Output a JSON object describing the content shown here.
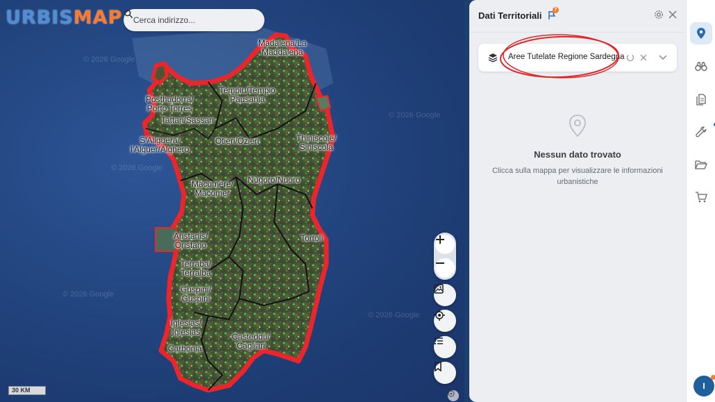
{
  "app": {
    "logo_part1": "URBIS",
    "logo_part2": "MAP"
  },
  "search": {
    "placeholder": "Cerca indirizzo..."
  },
  "map": {
    "labels": [
      "Madalena/La\nMaddalena",
      "Tempiu/Tempio\nPausania",
      "Posthudorra/\nPorto Torres",
      "Tattari/Sassari",
      "S'Aliguera/\nl'Alguer/Alghero",
      "Otieri/Ozieri",
      "Thiniscole/\nSiniscola",
      "Macumere/\nMacomer",
      "Nùgoro/Nuoro",
      "Aristanis/\nOristano",
      "Tortolì",
      "Terraba/\nTerralba",
      "Guspini/\nGuspini",
      "Iglesias/\nIglesias",
      "Casteddu/\nCagliari",
      "Carbonia"
    ],
    "watermarks": [
      "© 2026 Google",
      "© 2026 Google",
      "© 2026 Google",
      "© 2026 Google",
      "© 2026 Google"
    ],
    "scale_label": "30 KM"
  },
  "panel": {
    "title": "Dati Territoriali",
    "notification_count": "7",
    "layer_name": "Aree Tutelate Regione Sardegna",
    "empty_title": "Nessun dato trovato",
    "empty_description": "Clicca sulla mappa per visualizzare le informazioni urbanistiche"
  },
  "user": {
    "avatar_initial": "I"
  },
  "colors": {
    "accent": "#2b6cb0",
    "logo_orange": "#ff7a2b",
    "protected_area_red": "#e8262b",
    "annotation_red": "#e0262b"
  }
}
